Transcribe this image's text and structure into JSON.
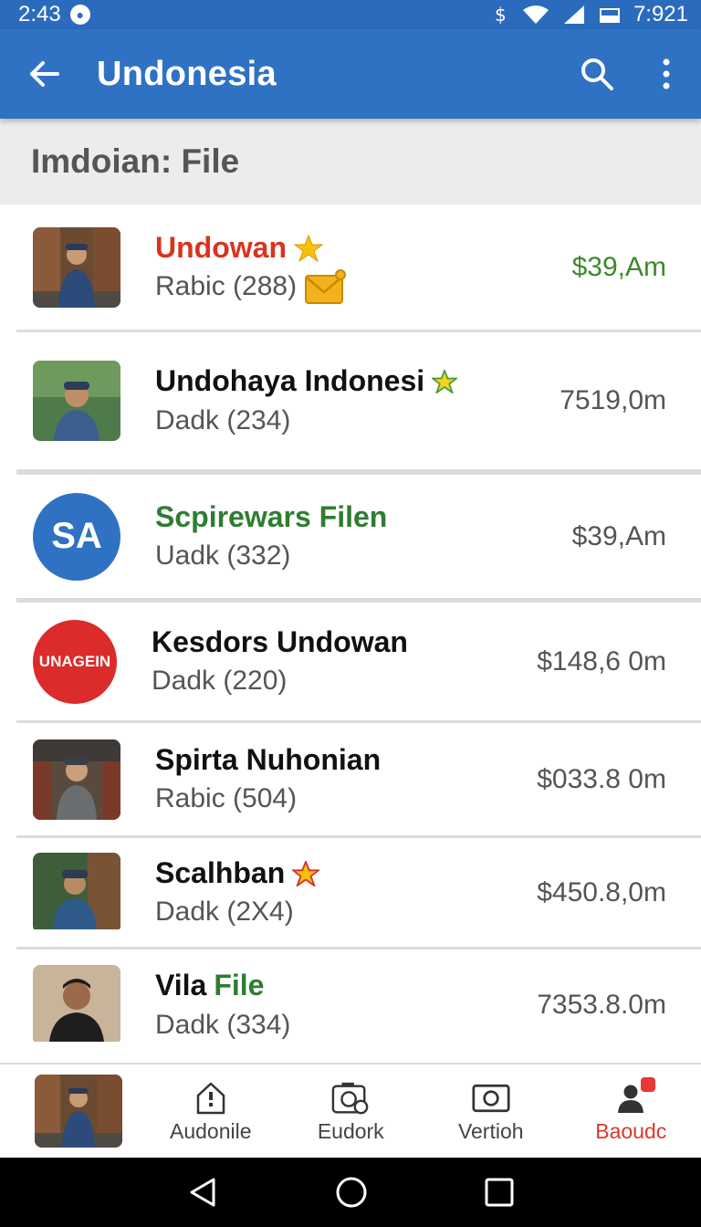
{
  "status_bar": {
    "time": "2:43",
    "clock": "7:921"
  },
  "app_bar": {
    "title": "Undonesia"
  },
  "section": {
    "title": "Imdoian: File"
  },
  "items": [
    {
      "name": "Undowan",
      "sub": "Rabic (288)",
      "price": "$39,Am"
    },
    {
      "name": "Undohaya Indonesi",
      "sub": "Dadk (234)",
      "price": "7519,0m"
    },
    {
      "name": "Scpirewars Filen",
      "sub": "Uadk (332)",
      "price": "$39,Am",
      "avatar_text": "SA"
    },
    {
      "name": "Kesdors Undowan",
      "sub": "Dadk (220)",
      "price": "$148,6 0m",
      "avatar_text": "UNAGEIN"
    },
    {
      "name": "Spirta Nuhonian",
      "sub": "Rabic (504)",
      "price": "$033.8 0m"
    },
    {
      "name": "Scalhban",
      "sub": "Dadk (2X4)",
      "price": "$450.8,0m"
    },
    {
      "name_prefix": "Vila",
      "name_highlight": "File",
      "sub": "Dadk (334)",
      "price": "7353.8.0m"
    }
  ],
  "bottom_nav": [
    {
      "label": "Audonile",
      "icon": "house-icon"
    },
    {
      "label": "Eudork",
      "icon": "camera-icon"
    },
    {
      "label": "Vertioh",
      "icon": "photo-icon"
    },
    {
      "label": "Baoudc",
      "icon": "profile-icon"
    }
  ],
  "colors": {
    "appbar": "#2f72c4",
    "status": "#2a6bbd",
    "price_green": "#3b8a2a",
    "name_red": "#d9331f",
    "name_green": "#2e7d32",
    "active_nav": "#d93a2a"
  }
}
